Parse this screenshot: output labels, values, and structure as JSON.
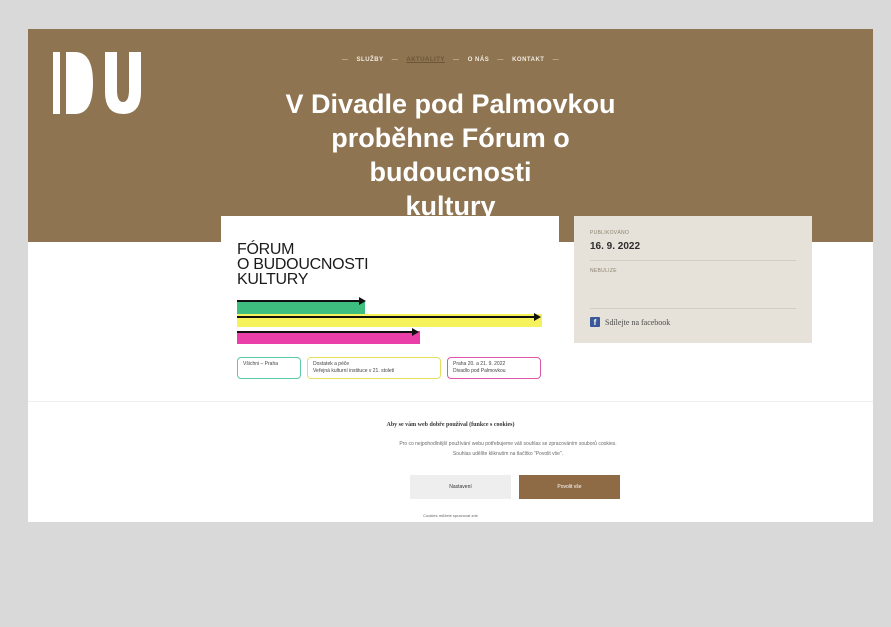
{
  "logo": {
    "text": "DU"
  },
  "nav": {
    "items": [
      {
        "label": "SLUŽBY",
        "active": false
      },
      {
        "label": "AKTUALITY",
        "active": true
      },
      {
        "label": "O NÁS",
        "active": false
      },
      {
        "label": "KONTAKT",
        "active": false
      }
    ],
    "separator": "—"
  },
  "headline": {
    "line1": "V Divadle pod Palmovkou",
    "line2": "proběhne Fórum o budoucnosti",
    "line3": "kultury"
  },
  "poster": {
    "title_lines": [
      "FÓRUM",
      "O BUDOUCNOSTI",
      "KULTURY"
    ],
    "bar_colors": {
      "green": "#3fbf7f",
      "yellow": "#f6f25b",
      "pink": "#ea3ea8"
    },
    "tags": [
      {
        "line1": "Všichni – Praha",
        "line2": "",
        "border": "#5cc9a5"
      },
      {
        "line1": "Dostatek a péče",
        "line2": "Veřejná kulturní instituce v 21. století",
        "border": "#e6df5e"
      },
      {
        "line1": "Praha 20. a 21. 9. 2022",
        "line2": "Divadlo pod Palmovkou",
        "border": "#e056a8"
      }
    ]
  },
  "meta": {
    "published_label": "PUBLIKOVÁNO",
    "date": "16. 9. 2022",
    "tags_label": "NEBULIZE",
    "share_label": "Sdílejte na facebook"
  },
  "cookie": {
    "title": "Aby se vám web dobře používal (funkce s cookies)",
    "text_line1": "Pro co nejpohodlnější používání webu potřebujeme váš souhlas se zpracováním souborů cookies.",
    "text_line2": "Souhlas udělíte kliknutím na tlačítko \"Povolit vše\".",
    "settings_label": "Nastavení",
    "accept_label": "Povolit vše",
    "footer_text": "Cookies můžete spravovat zde"
  },
  "colors": {
    "hero": "#8e7451",
    "meta_box": "#e7e2d9",
    "accept_button": "#8e6a45"
  }
}
